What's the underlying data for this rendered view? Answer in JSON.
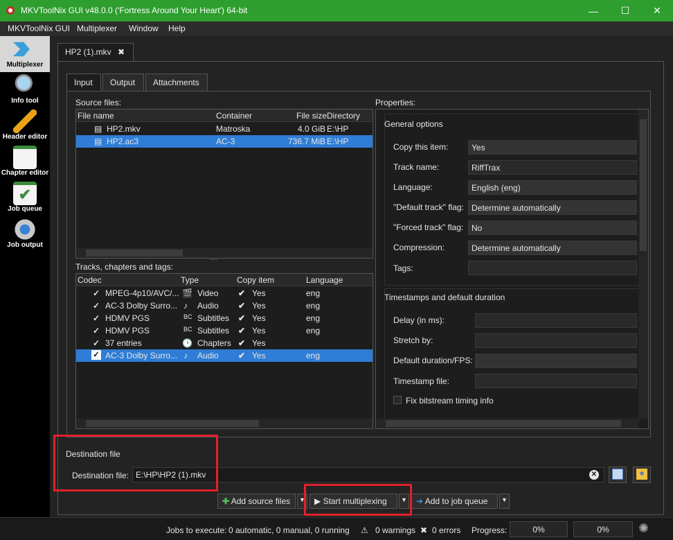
{
  "window": {
    "title": "MKVToolNix GUI v48.0.0 ('Fortress Around Your Heart') 64-bit",
    "minimize": "—",
    "maximize": "☐",
    "close": "✕"
  },
  "menu": [
    "MKVToolNix GUI",
    "Multiplexer",
    "Window",
    "Help"
  ],
  "sidebar": [
    {
      "label": "Multiplexer",
      "icon": "multiplexer-icon",
      "active": true
    },
    {
      "label": "Info tool",
      "icon": "magnifier-icon"
    },
    {
      "label": "Header editor",
      "icon": "pencil-icon"
    },
    {
      "label": "Chapter editor",
      "icon": "notepad-icon"
    },
    {
      "label": "Job queue",
      "icon": "checklist-icon"
    },
    {
      "label": "Job output",
      "icon": "gear-icon"
    }
  ],
  "file_tab": {
    "label": "HP2 (1).mkv"
  },
  "subtabs": [
    "Input",
    "Output",
    "Attachments"
  ],
  "source_files": {
    "label": "Source files:",
    "columns": [
      "File name",
      "Container",
      "File size",
      "Directory"
    ],
    "rows": [
      {
        "name": "HP2.mkv",
        "container": "Matroska",
        "size": "4.0 GiB",
        "dir": "E:\\HP"
      },
      {
        "name": "HP2.ac3",
        "container": "AC-3",
        "size": "736.7 MiB",
        "dir": "E:\\HP",
        "selected": true
      }
    ]
  },
  "tracks": {
    "label": "Tracks, chapters and tags:",
    "columns": [
      "Codec",
      "Type",
      "Copy item",
      "Language"
    ],
    "rows": [
      {
        "codec": "MPEG-4p10/AVC/...",
        "type": "Video",
        "copy": "Yes",
        "lang": "eng"
      },
      {
        "codec": "AC-3 Dolby Surro...",
        "type": "Audio",
        "copy": "Yes",
        "lang": "eng"
      },
      {
        "codec": "HDMV PGS",
        "type": "Subtitles",
        "copy": "Yes",
        "lang": "eng"
      },
      {
        "codec": "HDMV PGS",
        "type": "Subtitles",
        "copy": "Yes",
        "lang": "eng"
      },
      {
        "codec": "37 entries",
        "type": "Chapters",
        "copy": "Yes",
        "lang": ""
      },
      {
        "codec": "AC-3 Dolby Surro...",
        "type": "Audio",
        "copy": "Yes",
        "lang": "eng",
        "selected": true
      }
    ]
  },
  "properties": {
    "label": "Properties:",
    "general": {
      "title": "General options",
      "copy_label": "Copy this item:",
      "copy_value": "Yes",
      "name_label": "Track name:",
      "name_value": "RiffTrax",
      "lang_label": "Language:",
      "lang_value": "English (eng)",
      "default_label": "\"Default track\" flag:",
      "default_value": "Determine automatically",
      "forced_label": "\"Forced track\" flag:",
      "forced_value": "No",
      "comp_label": "Compression:",
      "comp_value": "Determine automatically",
      "tags_label": "Tags:"
    },
    "timestamps": {
      "title": "Timestamps and default duration",
      "delay_label": "Delay (in ms):",
      "stretch_label": "Stretch by:",
      "duration_label": "Default duration/FPS:",
      "file_label": "Timestamp file:",
      "fix_label": "Fix bitstream timing info"
    }
  },
  "destination": {
    "title": "Destination file",
    "label": "Destination file:",
    "value": "E:\\HP\\HP2 (1).mkv"
  },
  "actions": {
    "add_source": "Add source files",
    "start": "Start multiplexing",
    "add_queue": "Add to job queue"
  },
  "status": {
    "jobs_label": "Jobs to execute:",
    "jobs_value": "0 automatic, 0 manual, 0 running",
    "warnings": "0 warnings",
    "errors": "0 errors",
    "progress_label": "Progress:",
    "progress1": "0%",
    "progress2": "0%"
  }
}
